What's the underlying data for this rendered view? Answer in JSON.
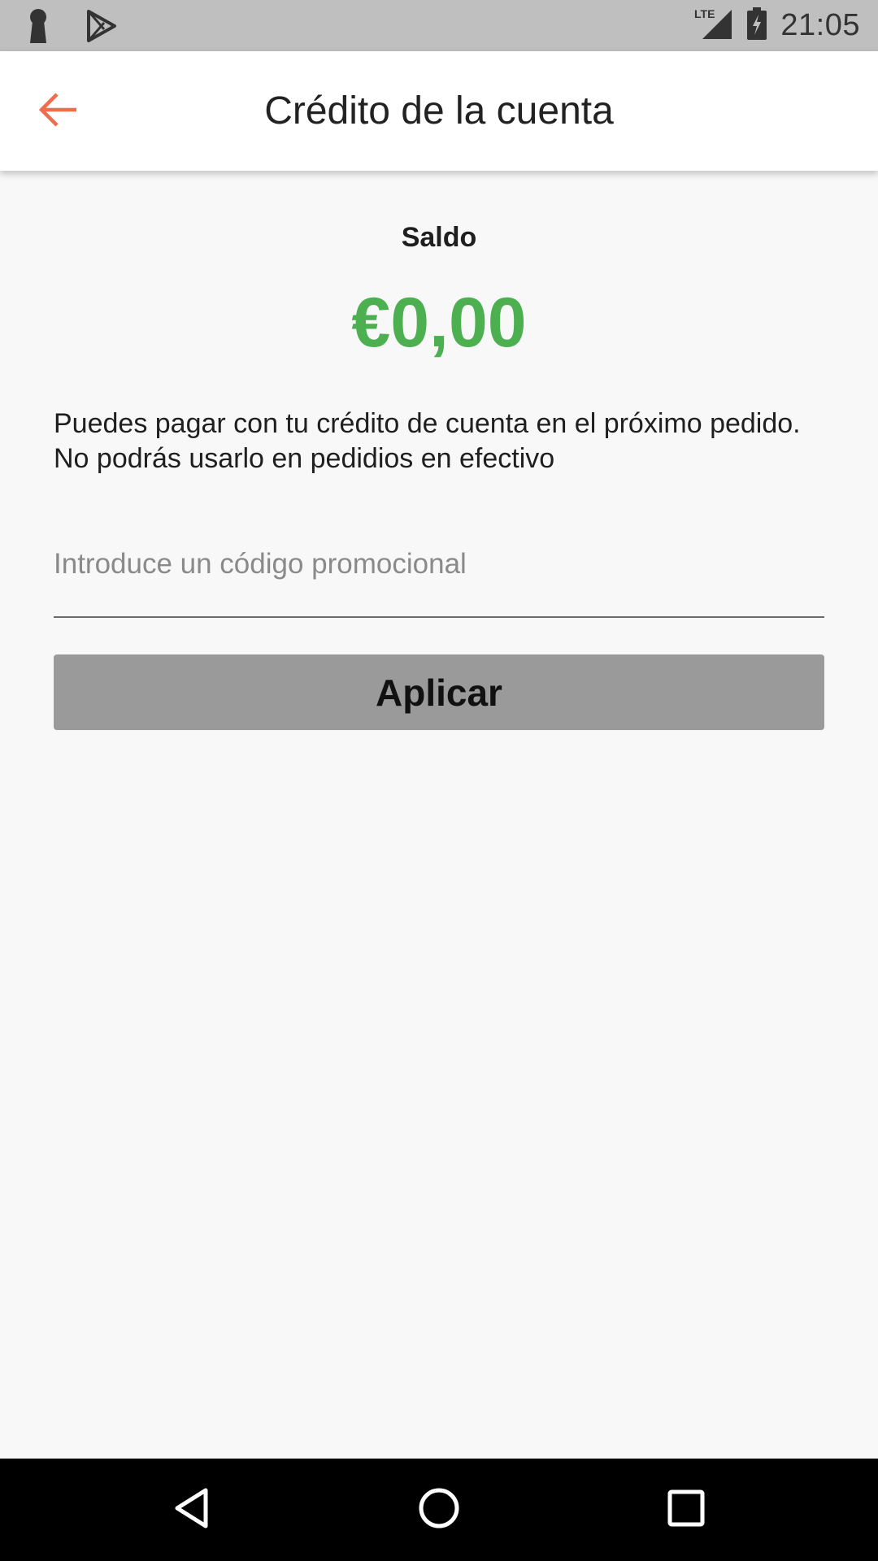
{
  "status_bar": {
    "time": "21:05",
    "network_label": "LTE",
    "icons": [
      "keyhole-icon",
      "play-store-icon",
      "lte-signal-icon",
      "battery-charging-icon"
    ]
  },
  "app_bar": {
    "title": "Crédito de la cuenta",
    "back_icon": "arrow-back-icon",
    "accent_color": "#ef6c4f"
  },
  "balance": {
    "label": "Saldo",
    "amount": "€0,00",
    "amount_color": "#4caf50"
  },
  "info": {
    "text": "Puedes pagar con tu crédito de cuenta en el próximo pedido. No podrás usarlo en pedidios en efectivo"
  },
  "promo": {
    "value": "",
    "placeholder": "Introduce un código promocional"
  },
  "apply_button": {
    "label": "Aplicar"
  },
  "nav_bar": {
    "icons": [
      "back-triangle-icon",
      "home-circle-icon",
      "recents-square-icon"
    ]
  }
}
